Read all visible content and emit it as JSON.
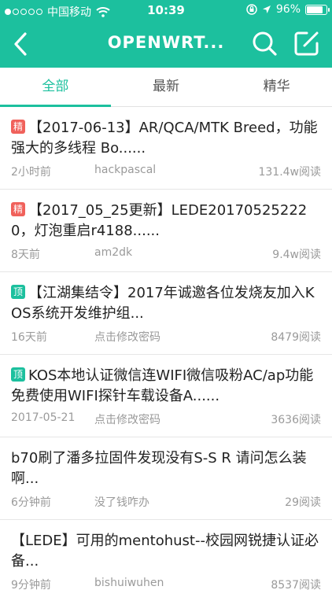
{
  "status_bar": {
    "carrier": "中国移动",
    "time": "10:39",
    "battery": "96%"
  },
  "nav": {
    "title": "OPENWRT...",
    "back_icon": "back-arrow-icon",
    "search_icon": "search-icon",
    "edit_icon": "compose-icon"
  },
  "tabs": [
    {
      "label": "全部"
    },
    {
      "label": "最新"
    },
    {
      "label": "精华"
    }
  ],
  "colors": {
    "accent": "#1cc09e",
    "badge_jing": "#f0615b",
    "badge_ding": "#1cc09e"
  },
  "posts": [
    {
      "badge": "精",
      "title": "【2017-06-13】AR/QCA/MTK Breed，功能强大的多线程 Bo......",
      "time": "2小时前",
      "author": "hackpascal",
      "reads": "131.4w阅读"
    },
    {
      "badge": "精",
      "title": "【2017_05_25更新】LEDE201705252220，灯泡重启r4188......",
      "time": "8天前",
      "author": "am2dk",
      "reads": "9.4w阅读"
    },
    {
      "badge": "顶",
      "title": "【江湖集结令】2017年诚邀各位发烧友加入KOS系统开发维护组...",
      "time": "16天前",
      "author": "点击修改密码",
      "reads": "8479阅读"
    },
    {
      "badge": "顶",
      "title": "KOS本地认证微信连WIFI微信吸粉AC/ap功能免费使用WIFI探针车载设备A......",
      "time": "2017-05-21",
      "author": "点击修改密码",
      "reads": "3636阅读"
    },
    {
      "badge": "",
      "title": "b70刷了潘多拉固件发现没有S-S R 请问怎么装啊...",
      "time": "6分钟前",
      "author": "没了钱咋办",
      "reads": "29阅读"
    },
    {
      "badge": "",
      "title": "【LEDE】可用的mentohust--校园网锐捷认证必备...",
      "time": "9分钟前",
      "author": "bishuiwuhen",
      "reads": "8537阅读"
    }
  ]
}
